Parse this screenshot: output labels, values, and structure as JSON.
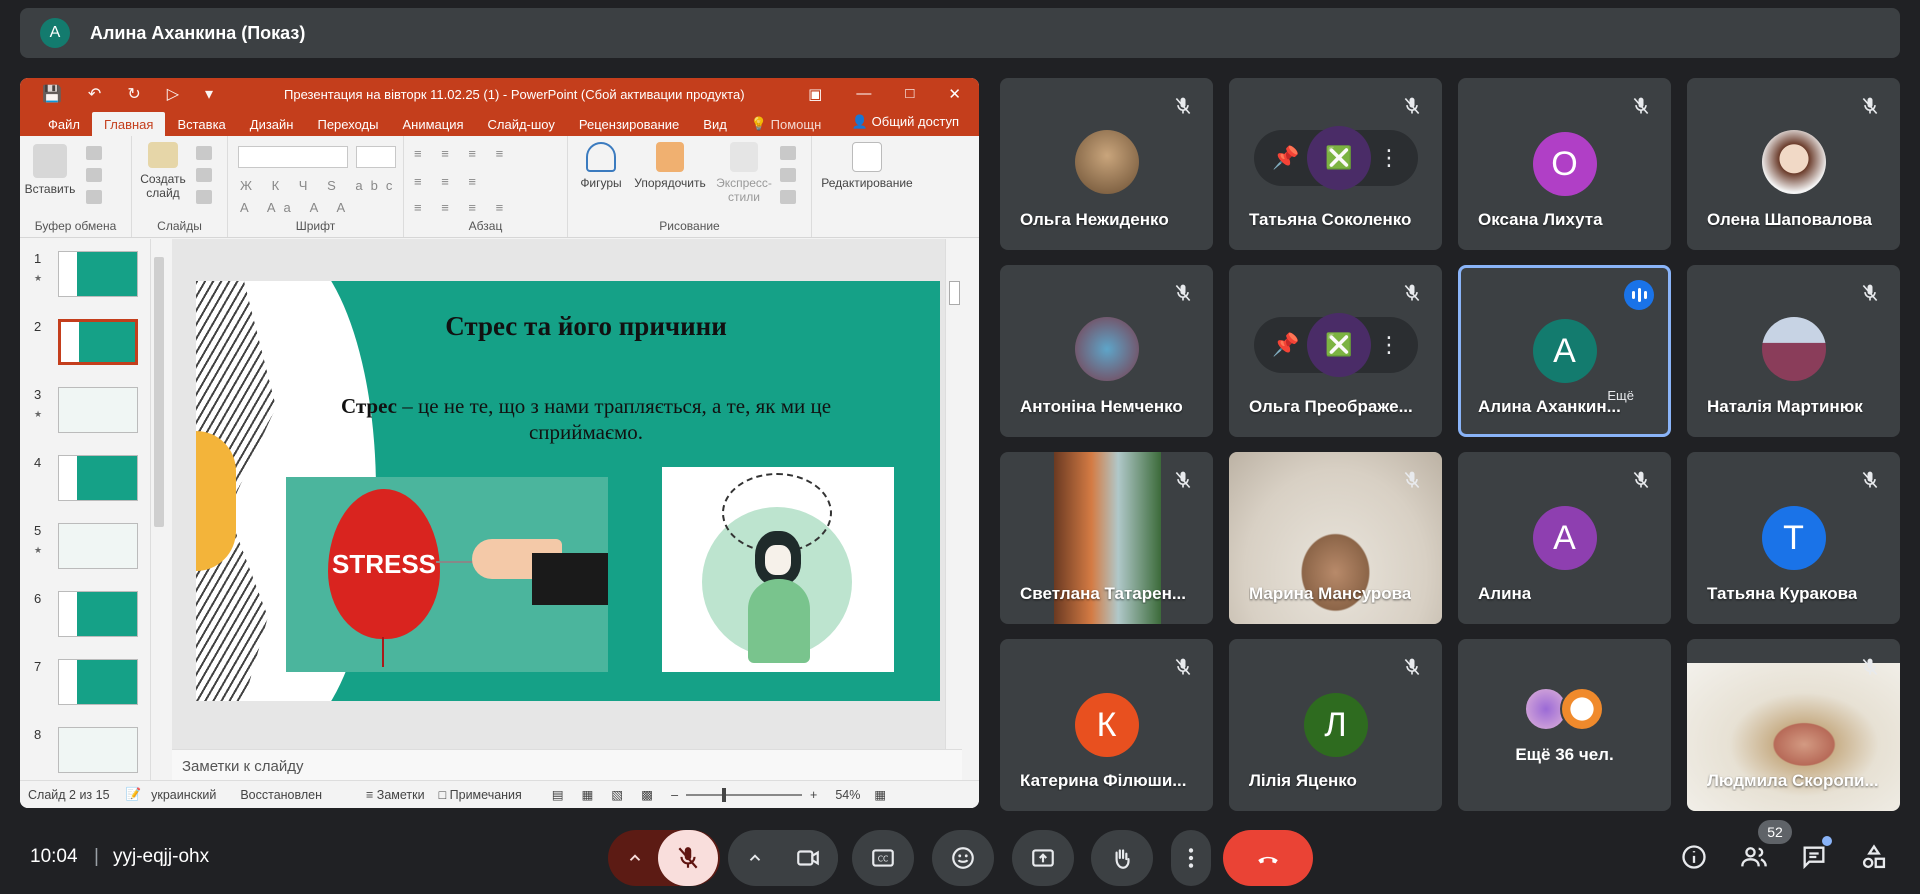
{
  "presenter": {
    "initial": "А",
    "title": "Алина Аханкина (Показ)"
  },
  "ppt": {
    "window_title": "Презентация на вівторк 11.02.25 (1) - PowerPoint (Сбой активации продукта)",
    "tabs": [
      "Файл",
      "Главная",
      "Вставка",
      "Дизайн",
      "Переходы",
      "Анимация",
      "Слайд-шоу",
      "Рецензирование",
      "Вид"
    ],
    "tell_me": "Помощн",
    "share": "Общий доступ",
    "ribbon": {
      "paste": "Вставить",
      "new_slide_1": "Создать",
      "new_slide_2": "слайд",
      "shapes": "Фигуры",
      "arrange": "Упорядочить",
      "quick_styles_1": "Экспресс-",
      "quick_styles_2": "стили",
      "editing": "Редактирование",
      "groups": [
        "Буфер обмена",
        "Слайды",
        "Шрифт",
        "Абзац",
        "Рисование"
      ]
    },
    "slide_numbers": [
      "1",
      "2",
      "3",
      "4",
      "5",
      "6",
      "7",
      "8"
    ],
    "slide": {
      "title": "Стрес та його причини",
      "text_bold": "Стрес",
      "text_rest": " – це не те, що з нами трапляється, а те, як ми це сприймаємо.",
      "balloon_text": "STRESS"
    },
    "notes_placeholder": "Заметки к слайду",
    "status": {
      "slide_of": "Слайд 2 из 15",
      "language": "украинский",
      "recovered": "Восстановлен",
      "notes": "Заметки",
      "comments": "Примечания",
      "zoom": "54%"
    }
  },
  "participants": [
    {
      "name": "Ольга Нежиденко",
      "type": "photo",
      "photo_color": "#8a6a4a"
    },
    {
      "name": "Татьяна Соколенко",
      "type": "controls"
    },
    {
      "name": "Оксана Лихута",
      "type": "initial",
      "initial": "О",
      "color": "#b03fc6"
    },
    {
      "name": "Олена Шаповалова",
      "type": "photo",
      "photo_color": "#d8c3b2"
    },
    {
      "name": "Антоніна Немченко",
      "type": "photo",
      "photo_color": "#5ea5c9"
    },
    {
      "name": "Ольга Преображе...",
      "type": "controls"
    },
    {
      "name": "Алина Аханкин...",
      "type": "initial",
      "initial": "А",
      "color": "#137b6e",
      "more": "Ещё"
    },
    {
      "name": "Наталія Мартинюк",
      "type": "photo",
      "photo_color": "#b5b8c8"
    },
    {
      "name": "Светлана Татарен...",
      "type": "video"
    },
    {
      "name": "Марина Мансурова",
      "type": "video"
    },
    {
      "name": "Алина",
      "type": "initial",
      "initial": "А",
      "color": "#8e3fb0"
    },
    {
      "name": "Татьяна Куракова",
      "type": "initial",
      "initial": "Т",
      "color": "#1a73e8"
    },
    {
      "name": "Катерина Філюши...",
      "type": "initial",
      "initial": "К",
      "color": "#e8501f"
    },
    {
      "name": "Лілія Яценко",
      "type": "initial",
      "initial": "Л",
      "color": "#2e6b1f"
    },
    {
      "name": "Ещё 36 чел.",
      "type": "more"
    },
    {
      "name": "Людмила Скоропи...",
      "type": "video"
    }
  ],
  "bottom": {
    "time": "10:04",
    "separator": "|",
    "meeting_code": "yyj-eqjj-ohx",
    "people_count": "52"
  },
  "colors": {
    "bg": "#202124",
    "tile": "#3c4043",
    "ppt_accent": "#c43e1c",
    "slide_green": "#15a187",
    "end_call": "#ea4335"
  }
}
